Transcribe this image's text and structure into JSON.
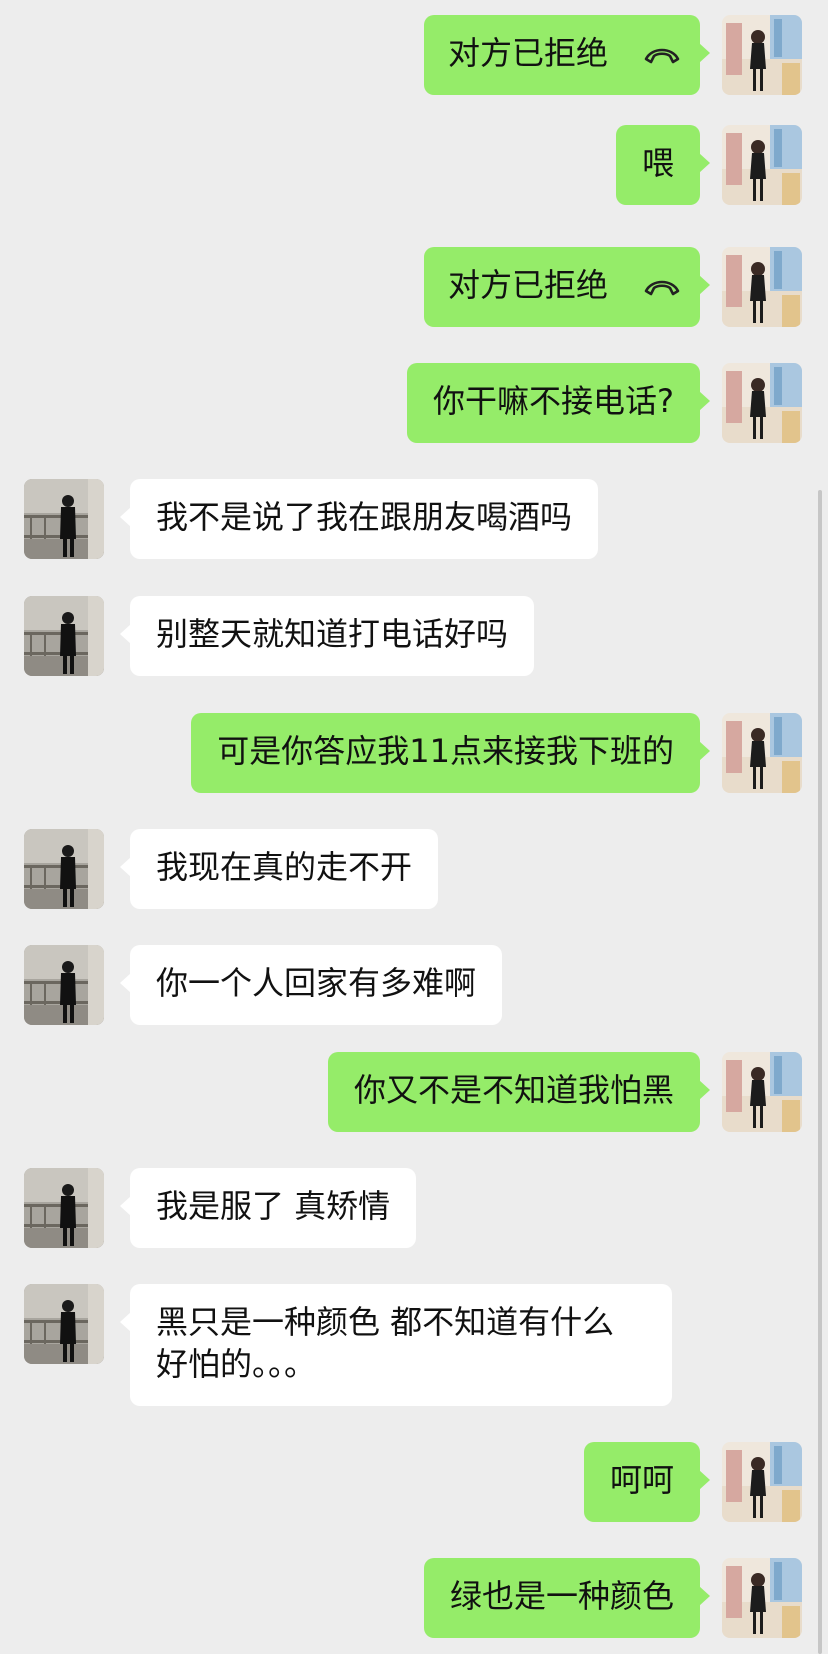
{
  "messages": [
    {
      "side": "me",
      "text": "对方已拒绝",
      "call": true
    },
    {
      "side": "me",
      "text": "喂"
    },
    {
      "side": "me",
      "text": "对方已拒绝",
      "call": true
    },
    {
      "side": "me",
      "text": "你干嘛不接电话?"
    },
    {
      "side": "peer",
      "text": "我不是说了我在跟朋友喝酒吗"
    },
    {
      "side": "peer",
      "text": "别整天就知道打电话好吗"
    },
    {
      "side": "me",
      "text": "可是你答应我11点来接我下班的"
    },
    {
      "side": "peer",
      "text": "我现在真的走不开"
    },
    {
      "side": "peer",
      "text": "你一个人回家有多难啊"
    },
    {
      "side": "me",
      "text": "你又不是不知道我怕黑"
    },
    {
      "side": "peer",
      "text": "我是服了 真矫情"
    },
    {
      "side": "peer",
      "text": "黑只是一种颜色 都不知道有什么好怕的。。。"
    },
    {
      "side": "me",
      "text": "呵呵"
    },
    {
      "side": "me",
      "text": "绿也是一种颜色"
    }
  ],
  "colors": {
    "background": "#ededed",
    "me_bubble": "#95ec69",
    "peer_bubble": "#ffffff"
  },
  "icons": {
    "call": "hang-up-phone-icon"
  }
}
